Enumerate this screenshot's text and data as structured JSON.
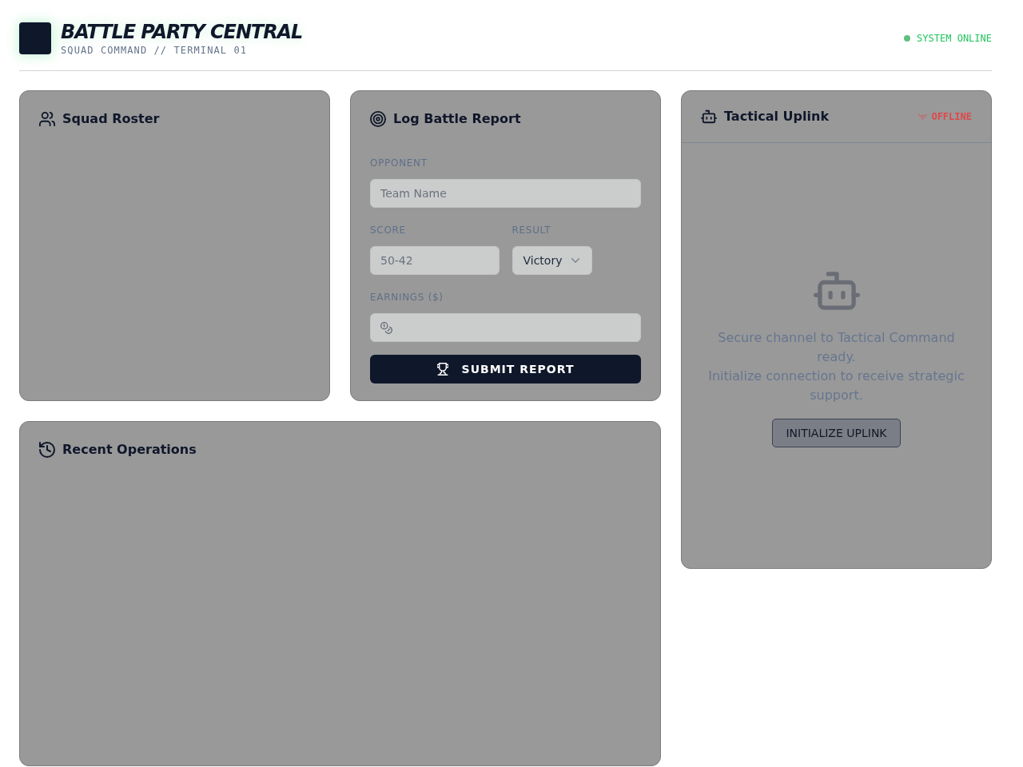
{
  "header": {
    "title": "BATTLE PARTY CENTRAL",
    "subtitle": "SQUAD COMMAND // TERMINAL 01",
    "status": {
      "label": "SYSTEM ONLINE",
      "online": true
    }
  },
  "squad_roster": {
    "title": "Squad Roster"
  },
  "battle_report": {
    "title": "Log Battle Report",
    "rows": [
      {
        "fields": [
          {
            "kind": "text",
            "label": "OPPONENT",
            "placeholder": "Team Name"
          }
        ]
      },
      {
        "fields": [
          {
            "kind": "text",
            "label": "SCORE",
            "placeholder": "50-42"
          },
          {
            "kind": "select",
            "label": "RESULT",
            "value": "Victory"
          }
        ]
      },
      {
        "fields": [
          {
            "kind": "money",
            "label": "EARNINGS ($)"
          }
        ]
      }
    ],
    "submit": "SUBMIT REPORT"
  },
  "tactical_uplink": {
    "title": "Tactical Uplink",
    "connection": {
      "label": "OFFLINE",
      "online": false
    },
    "messages": [
      "Secure channel to Tactical Command ready.",
      "Initialize connection to receive strategic support."
    ],
    "button": "INITIALIZE UPLINK"
  },
  "recent_operations": {
    "title": "Recent Operations"
  }
}
